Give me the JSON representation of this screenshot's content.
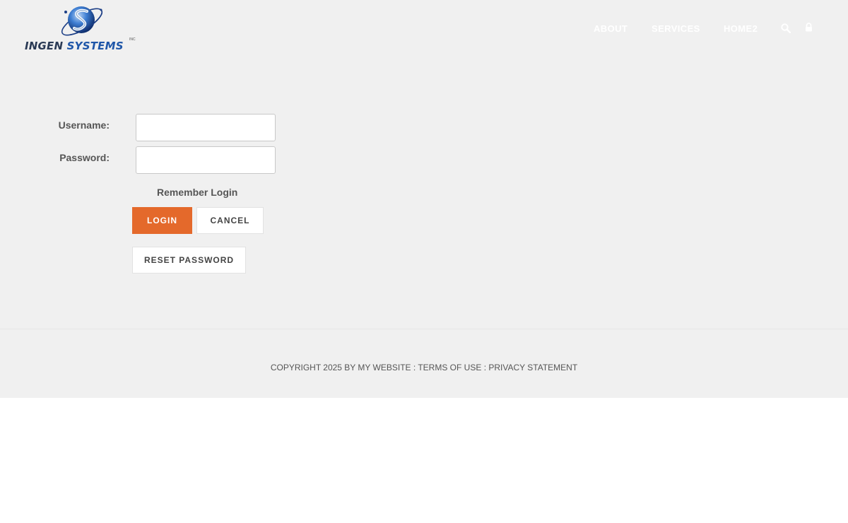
{
  "logo": {
    "text_part1": "INGEN",
    "text_part2": " SYSTEMS",
    "inc": "INC"
  },
  "nav": {
    "items": [
      "ABOUT",
      "SERVICES",
      "HOME2"
    ],
    "icons": [
      "search-icon",
      "lock-icon"
    ]
  },
  "login": {
    "username_label": "Username:",
    "password_label": "Password:",
    "username_value": "",
    "password_value": "",
    "remember_label": "Remember Login",
    "login_button": "LOGIN",
    "cancel_button": "CANCEL",
    "reset_button": "RESET PASSWORD"
  },
  "footer": {
    "copyright": "COPYRIGHT 2025 BY MY WEBSITE",
    "separator": " : ",
    "terms": "TERMS OF USE",
    "privacy": "PRIVACY STATEMENT"
  },
  "colors": {
    "accent": "#e4692b",
    "page_background": "#f0f0f0",
    "nav_text": "#ffffff",
    "logo_blue": "#1f56a8"
  }
}
